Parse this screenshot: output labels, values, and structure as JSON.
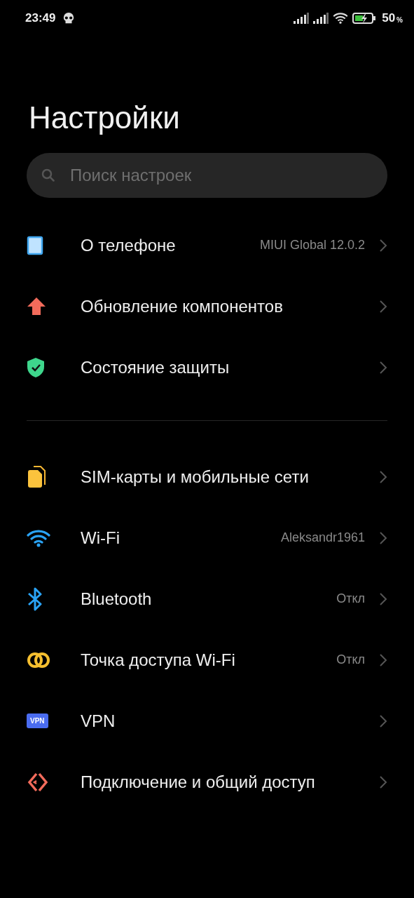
{
  "status_bar": {
    "time": "23:49",
    "battery": "50",
    "battery_unit": "%"
  },
  "title": "Настройки",
  "search": {
    "placeholder": "Поиск настроек"
  },
  "groups": [
    {
      "items": [
        {
          "kind": "phone",
          "label": "О телефоне",
          "value": "MIUI Global 12.0.2"
        },
        {
          "kind": "update",
          "label": "Обновление компонентов"
        },
        {
          "kind": "shield",
          "label": "Состояние защиты"
        }
      ]
    },
    {
      "items": [
        {
          "kind": "sim",
          "label": "SIM-карты и мобильные сети"
        },
        {
          "kind": "wifi",
          "label": "Wi-Fi",
          "value": "Aleksandr1961"
        },
        {
          "kind": "bluetooth",
          "label": "Bluetooth",
          "value": "Откл"
        },
        {
          "kind": "hotspot",
          "label": "Точка доступа Wi-Fi",
          "value": "Откл"
        },
        {
          "kind": "vpn",
          "label": "VPN",
          "icon_text": "VPN"
        },
        {
          "kind": "share",
          "label": "Подключение и общий доступ"
        }
      ]
    }
  ]
}
